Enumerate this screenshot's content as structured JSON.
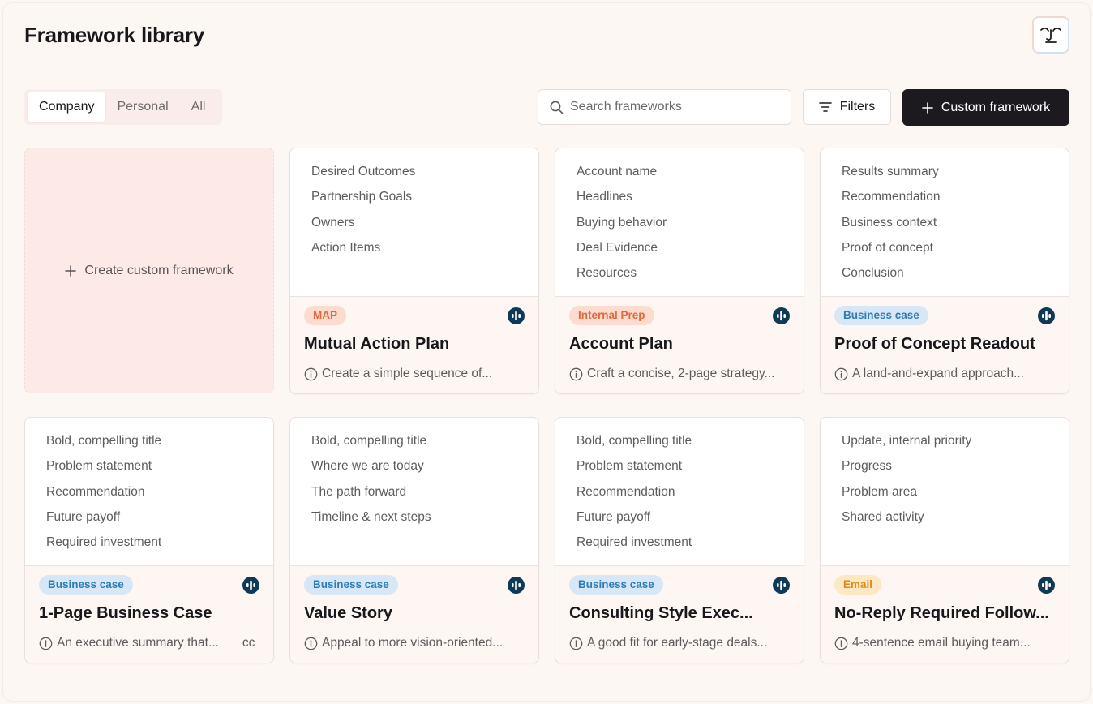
{
  "header": {
    "title": "Framework library",
    "logo_icon": "face-logo-icon"
  },
  "tabs": [
    {
      "label": "Company",
      "active": true
    },
    {
      "label": "Personal",
      "active": false
    },
    {
      "label": "All",
      "active": false
    }
  ],
  "search": {
    "placeholder": "Search frameworks",
    "value": ""
  },
  "filters_label": "Filters",
  "custom_button_label": "Custom framework",
  "create_card_label": "Create custom framework",
  "colors": {
    "accent_dark": "#1c1a1f",
    "badge_orange_bg": "#fcdccf",
    "badge_orange_text": "#e06a3e",
    "badge_blue_bg": "#d7e7f6",
    "badge_blue_text": "#2f7db8",
    "badge_yellow_bg": "#fde8c4",
    "badge_yellow_text": "#e0891a",
    "brand_icon": "#0e3a57"
  },
  "cards": [
    {
      "sections": [
        "Desired Outcomes",
        "Partnership Goals",
        "Owners",
        "Action Items"
      ],
      "tag": "MAP",
      "tag_style": "map",
      "title": "Mutual Action Plan",
      "description": "Create a simple sequence of...",
      "extra": ""
    },
    {
      "sections": [
        "Account name",
        "Headlines",
        "Buying behavior",
        "Deal Evidence",
        "Resources"
      ],
      "tag": "Internal Prep",
      "tag_style": "prep",
      "title": "Account Plan",
      "description": "Craft a concise, 2-page strategy...",
      "extra": ""
    },
    {
      "sections": [
        "Results summary",
        "Recommendation",
        "Business context",
        "Proof of concept",
        "Conclusion"
      ],
      "tag": "Business case",
      "tag_style": "biz",
      "title": "Proof of Concept Readout",
      "description": "A land-and-expand approach...",
      "extra": ""
    },
    {
      "sections": [
        "Bold, compelling title",
        "Problem statement",
        "Recommendation",
        "Future payoff",
        "Required investment"
      ],
      "tag": "Business case",
      "tag_style": "biz",
      "title": "1-Page Business Case",
      "description": "An executive summary that...",
      "extra": "cc"
    },
    {
      "sections": [
        "Bold, compelling title",
        "Where we are today",
        "The path forward",
        "Timeline & next steps"
      ],
      "tag": "Business case",
      "tag_style": "biz",
      "title": "Value Story",
      "description": "Appeal to more vision-oriented...",
      "extra": ""
    },
    {
      "sections": [
        "Bold, compelling title",
        "Problem statement",
        "Recommendation",
        "Future payoff",
        "Required investment"
      ],
      "tag": "Business case",
      "tag_style": "biz",
      "title": "Consulting Style Exec...",
      "description": "A good fit for early-stage deals...",
      "extra": ""
    },
    {
      "sections": [
        "Update, internal priority",
        "Progress",
        "Problem area",
        "Shared activity"
      ],
      "tag": "Email",
      "tag_style": "email",
      "title": "No-Reply Required Follow...",
      "description": "4-sentence email buying team...",
      "extra": ""
    }
  ]
}
